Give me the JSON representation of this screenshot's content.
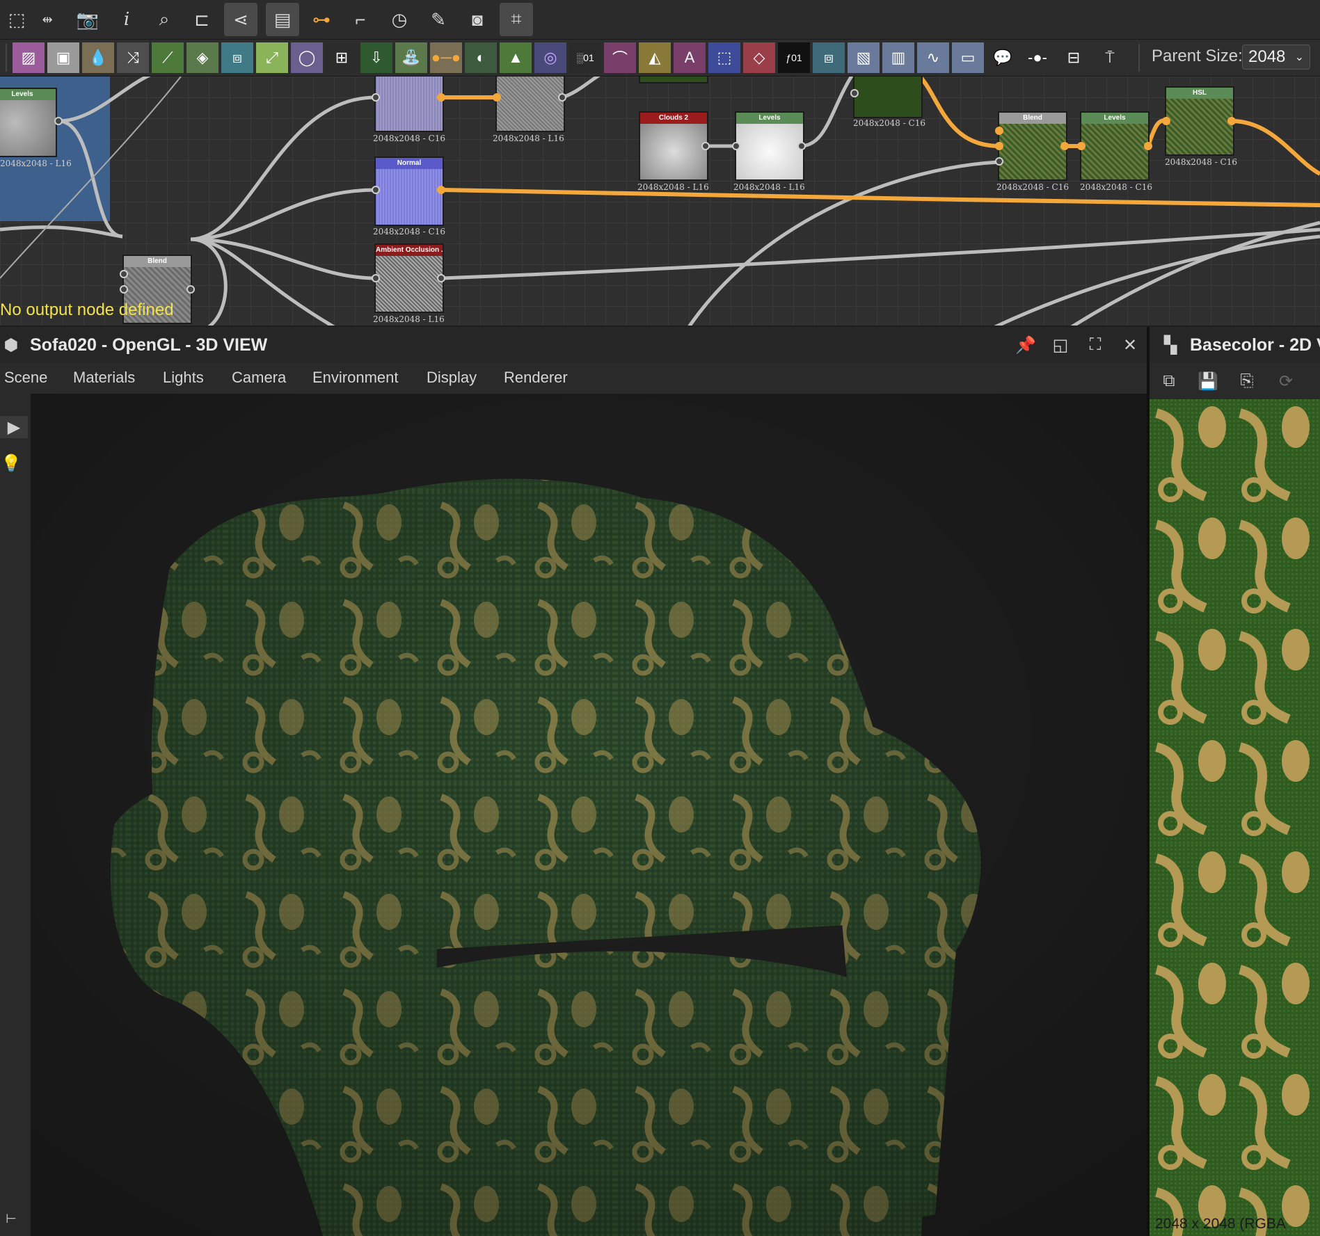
{
  "toolbar": {
    "top_icons": [
      "frame-icon",
      "fit-icon",
      "screenshot-icon",
      "info-icon",
      "search-icon",
      "align-icon",
      "graph-share-icon",
      "layers-icon",
      "link-icon",
      "pin-connect-icon",
      "timer-icon",
      "tools-icon",
      "render-icon",
      "crop-icon"
    ],
    "node_icons": [
      "bitmap-icon",
      "uniform-color-icon",
      "drop-icon",
      "shuffle-icon",
      "curve-icon",
      "gradient-drop-icon",
      "warp-icon",
      "transform-icon",
      "circle-icon",
      "grid-icon",
      "import-icon",
      "watering-can-icon",
      "slider-icon",
      "contrast-icon",
      "histogram-icon",
      "color-wheel-icon",
      "noise-icon",
      "path-icon",
      "mirror-icon",
      "text-icon",
      "selection-icon",
      "fill-icon",
      "function-icon",
      "pattern-icon",
      "tile-icon",
      "gradient-icon",
      "wave-icon",
      "frame-node-icon",
      "comment-icon",
      "dot-icon",
      "output-icon",
      "pin-icon"
    ],
    "parent_size_label": "Parent Size:",
    "parent_size_value": "2048"
  },
  "graph": {
    "warning": "No output node defined",
    "nodes": [
      {
        "id": "levels-1",
        "title": "Levels",
        "caption": "2048x2048 - L16"
      },
      {
        "id": "blend-1",
        "title": "Blend",
        "caption": ""
      },
      {
        "id": "c16-a",
        "title": "",
        "caption": "2048x2048 - C16"
      },
      {
        "id": "l16-a",
        "title": "",
        "caption": "2048x2048 - L16"
      },
      {
        "id": "normal",
        "title": "Normal",
        "caption": "2048x2048 - C16"
      },
      {
        "id": "ao",
        "title": "Ambient Occlusion ...",
        "caption": "2048x2048 - L16"
      },
      {
        "id": "clouds",
        "title": "Clouds 2",
        "caption": "2048x2048 - L16"
      },
      {
        "id": "levels-2",
        "title": "Levels",
        "caption": "2048x2048 - L16"
      },
      {
        "id": "green-top",
        "title": "",
        "caption": "2048x2048 - C16"
      },
      {
        "id": "blend-2",
        "title": "Blend",
        "caption": "2048x2048 - C16"
      },
      {
        "id": "levels-3",
        "title": "Levels",
        "caption": "2048x2048 - C16"
      },
      {
        "id": "hsl",
        "title": "HSL",
        "caption": "2048x2048 - C16"
      }
    ]
  },
  "view3d": {
    "title": "Sofa020 - OpenGL - 3D VIEW",
    "menu": [
      "Scene",
      "Materials",
      "Lights",
      "Camera",
      "Environment",
      "Display",
      "Renderer"
    ]
  },
  "view2d": {
    "title": "Basecolor - 2D V",
    "status": "2048 x 2048 (RGBA"
  },
  "colors": {
    "accent_wire": "#f4a83b",
    "grey_wire": "#bdbdbd",
    "fabric_green": "#2f4a2c",
    "fabric_gold": "#b59a55",
    "warning": "#f2e34b"
  }
}
